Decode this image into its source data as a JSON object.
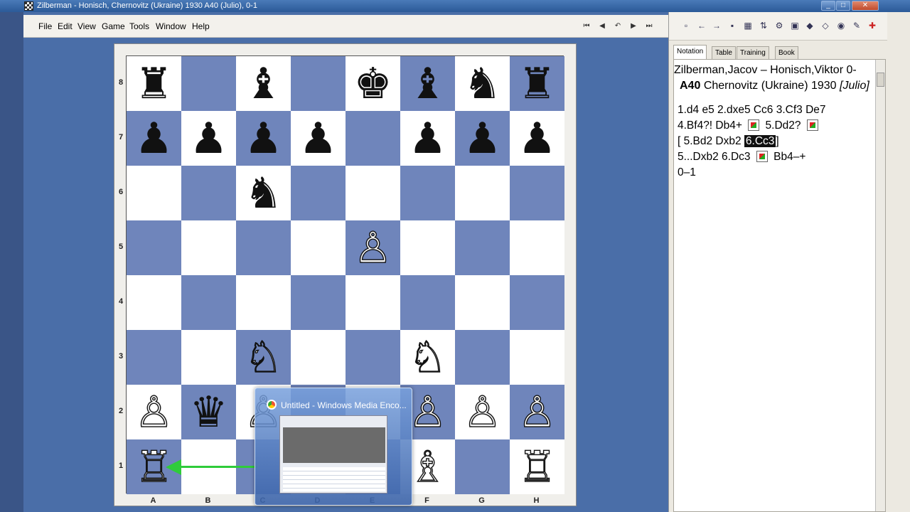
{
  "window": {
    "title": "Zilberman - Honisch, Chernovitz (Ukraine) 1930  A40  (Julio), 0-1",
    "controls": [
      "_",
      "□",
      "✕"
    ]
  },
  "menu": {
    "items": [
      {
        "label": "File"
      },
      {
        "label": "Edit"
      },
      {
        "label": "View"
      },
      {
        "label": "Game"
      },
      {
        "label": "Tools"
      },
      {
        "label": "Window"
      },
      {
        "label": "Help"
      }
    ],
    "nav_icons": [
      "first-move-icon",
      "previous-move-icon",
      "takeback-icon",
      "next-move-icon",
      "last-move-icon"
    ]
  },
  "board": {
    "rank_labels": [
      "8",
      "7",
      "6",
      "5",
      "4",
      "3",
      "2",
      "1"
    ],
    "file_labels": [
      "A",
      "B",
      "C",
      "D",
      "E",
      "F",
      "G",
      "H"
    ],
    "pieces": [
      {
        "sq": "a8",
        "glyph": "♜",
        "color": "black"
      },
      {
        "sq": "c8",
        "glyph": "♝",
        "color": "black"
      },
      {
        "sq": "e8",
        "glyph": "♚",
        "color": "black"
      },
      {
        "sq": "f8",
        "glyph": "♝",
        "color": "black"
      },
      {
        "sq": "g8",
        "glyph": "♞",
        "color": "black"
      },
      {
        "sq": "h8",
        "glyph": "♜",
        "color": "black"
      },
      {
        "sq": "a7",
        "glyph": "♟",
        "color": "black"
      },
      {
        "sq": "b7",
        "glyph": "♟",
        "color": "black"
      },
      {
        "sq": "c7",
        "glyph": "♟",
        "color": "black"
      },
      {
        "sq": "d7",
        "glyph": "♟",
        "color": "black"
      },
      {
        "sq": "f7",
        "glyph": "♟",
        "color": "black"
      },
      {
        "sq": "g7",
        "glyph": "♟",
        "color": "black"
      },
      {
        "sq": "h7",
        "glyph": "♟",
        "color": "black"
      },
      {
        "sq": "c6",
        "glyph": "♞",
        "color": "black"
      },
      {
        "sq": "e5",
        "glyph": "♙",
        "color": "white"
      },
      {
        "sq": "c3",
        "glyph": "♘",
        "color": "white"
      },
      {
        "sq": "f3",
        "glyph": "♘",
        "color": "white"
      },
      {
        "sq": "a2",
        "glyph": "♙",
        "color": "white"
      },
      {
        "sq": "b2",
        "glyph": "♛",
        "color": "black"
      },
      {
        "sq": "c2",
        "glyph": "♙",
        "color": "white"
      },
      {
        "sq": "f2",
        "glyph": "♙",
        "color": "white"
      },
      {
        "sq": "g2",
        "glyph": "♙",
        "color": "white"
      },
      {
        "sq": "h2",
        "glyph": "♙",
        "color": "white"
      },
      {
        "sq": "a1",
        "glyph": "♖",
        "color": "white"
      },
      {
        "sq": "f1",
        "glyph": "♗",
        "color": "white"
      },
      {
        "sq": "h1",
        "glyph": "♖",
        "color": "white"
      }
    ],
    "colors": {
      "light": "#ffffff",
      "dark": "#6f85bb",
      "arrow": "#2fcc3a"
    }
  },
  "taskbar_thumbnail": {
    "title": "Untitled - Windows Media Enco..."
  },
  "toolbar": {
    "icons": [
      "new-icon",
      "back-icon",
      "forward-icon",
      "save-icon",
      "database-icon",
      "sort-icon",
      "engine-icon",
      "window-icon",
      "eraser-icon",
      "eraser2-icon",
      "camera-icon",
      "report-icon",
      "add-icon"
    ]
  },
  "tabs": [
    {
      "label": "Notation",
      "active": true
    },
    {
      "label": "Table",
      "active": false
    },
    {
      "label": "Training",
      "active": false
    },
    {
      "label": "Book",
      "active": false
    }
  ],
  "notation": {
    "players": "Zilberman,Jacov – Honisch,Viktor  0-",
    "eco": "A40",
    "event": "Chernovitz (Ukraine) 1930",
    "annotator": "[Julio]",
    "lines": [
      [
        {
          "t": "1.d4  e5  2.dxe5  Cc6  3.Cf3  De7"
        }
      ],
      [
        {
          "t": "4.Bf4?!  Db4+ "
        },
        {
          "diag": true
        },
        {
          "t": " 5.Dd2? "
        },
        {
          "diag": true
        }
      ],
      [
        {
          "t": "  [ 5.Bd2  Dxb2 "
        },
        {
          "t": "6.Cc3",
          "hl": true
        },
        {
          "t": "]"
        }
      ],
      [
        {
          "t": "5...Dxb2  6.Dc3 "
        },
        {
          "diag": true
        },
        {
          "t": " Bb4–+"
        }
      ],
      [
        {
          "t": "0–1"
        }
      ]
    ]
  }
}
